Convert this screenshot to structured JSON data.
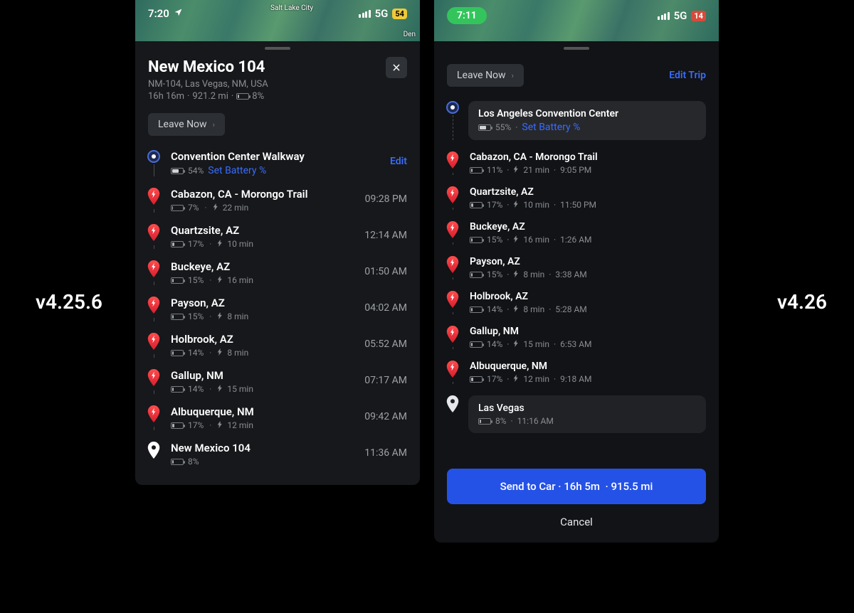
{
  "labels": {
    "version_left": "v4.25.6",
    "version_right": "v4.26",
    "leave_now": "Leave Now",
    "edit": "Edit",
    "edit_trip": "Edit Trip",
    "set_battery": "Set Battery %",
    "cancel": "Cancel",
    "send_to_car": "Send to Car",
    "salt_lake": "Salt Lake City",
    "denver": "Den"
  },
  "left": {
    "status": {
      "time": "7:20",
      "network": "5G",
      "battery": "54"
    },
    "header": {
      "title": "New Mexico 104",
      "subtitle": "NM-104, Las Vegas, NM, USA",
      "duration": "16h 16m",
      "distance": "921.2 mi",
      "arrive_pct": "8%"
    },
    "start": {
      "name": "Convention Center Walkway",
      "battery": "54%"
    },
    "stops": [
      {
        "name": "Cabazon, CA - Morongo Trail",
        "battery": "7%",
        "charge": "22 min",
        "time": "09:28 PM"
      },
      {
        "name": "Quartzsite, AZ",
        "battery": "17%",
        "charge": "10 min",
        "time": "12:14 AM"
      },
      {
        "name": "Buckeye, AZ",
        "battery": "15%",
        "charge": "16 min",
        "time": "01:50 AM"
      },
      {
        "name": "Payson, AZ",
        "battery": "15%",
        "charge": "8 min",
        "time": "04:02 AM"
      },
      {
        "name": "Holbrook, AZ",
        "battery": "14%",
        "charge": "8 min",
        "time": "05:52 AM"
      },
      {
        "name": "Gallup, NM",
        "battery": "14%",
        "charge": "15 min",
        "time": "07:17 AM"
      },
      {
        "name": "Albuquerque, NM",
        "battery": "17%",
        "charge": "12 min",
        "time": "09:42 AM"
      }
    ],
    "end": {
      "name": "New Mexico 104",
      "battery": "8%",
      "time": "11:36 AM"
    }
  },
  "right": {
    "status": {
      "time": "7:11",
      "network": "5G",
      "battery": "14"
    },
    "start": {
      "name": "Los Angeles Convention Center",
      "battery": "55%"
    },
    "stops": [
      {
        "name": "Cabazon, CA - Morongo Trail",
        "battery": "11%",
        "charge": "21 min",
        "time": "9:05 PM"
      },
      {
        "name": "Quartzsite, AZ",
        "battery": "17%",
        "charge": "10 min",
        "time": "11:50 PM"
      },
      {
        "name": "Buckeye, AZ",
        "battery": "15%",
        "charge": "16 min",
        "time": "1:26 AM"
      },
      {
        "name": "Payson, AZ",
        "battery": "15%",
        "charge": "8 min",
        "time": "3:38 AM"
      },
      {
        "name": "Holbrook, AZ",
        "battery": "14%",
        "charge": "8 min",
        "time": "5:28 AM"
      },
      {
        "name": "Gallup, NM",
        "battery": "14%",
        "charge": "15 min",
        "time": "6:53 AM"
      },
      {
        "name": "Albuquerque, NM",
        "battery": "17%",
        "charge": "12 min",
        "time": "9:18 AM"
      }
    ],
    "end": {
      "name": "Las Vegas",
      "battery": "8%",
      "time": "11:16 AM"
    },
    "summary": {
      "duration": "16h 5m",
      "distance": "915.5 mi"
    }
  }
}
